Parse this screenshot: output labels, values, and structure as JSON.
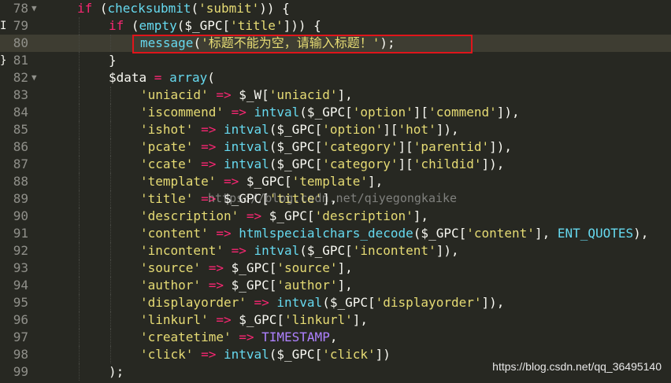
{
  "lines": [
    {
      "n": "78",
      "fold": "▼",
      "mark": "",
      "segs": [
        {
          "t": "if",
          "c": "kw"
        },
        {
          "t": " (",
          "c": "plain"
        },
        {
          "t": "checksubmit",
          "c": "fn"
        },
        {
          "t": "(",
          "c": "plain"
        },
        {
          "t": "'submit'",
          "c": "str"
        },
        {
          "t": ")) {",
          "c": "plain"
        }
      ],
      "indent": 1
    },
    {
      "n": "79",
      "fold": "",
      "mark": "I",
      "segs": [
        {
          "t": "if",
          "c": "kw"
        },
        {
          "t": " (",
          "c": "plain"
        },
        {
          "t": "empty",
          "c": "fn"
        },
        {
          "t": "($_GPC[",
          "c": "plain"
        },
        {
          "t": "'title'",
          "c": "str"
        },
        {
          "t": "])) {",
          "c": "plain"
        }
      ],
      "indent": 2
    },
    {
      "n": "80",
      "fold": "",
      "mark": "",
      "active": true,
      "segs": [
        {
          "t": "message",
          "c": "fn"
        },
        {
          "t": "(",
          "c": "plain"
        },
        {
          "t": "'标题不能为空，请输入标题！'",
          "c": "str"
        },
        {
          "t": ");",
          "c": "plain"
        }
      ],
      "indent": 3
    },
    {
      "n": "81",
      "fold": "",
      "mark": "}",
      "segs": [
        {
          "t": "}",
          "c": "plain"
        }
      ],
      "indent": 2
    },
    {
      "n": "82",
      "fold": "▼",
      "mark": "",
      "segs": [
        {
          "t": "$data",
          "c": "plain"
        },
        {
          "t": " = ",
          "c": "op"
        },
        {
          "t": "array",
          "c": "fn"
        },
        {
          "t": "(",
          "c": "plain"
        }
      ],
      "indent": 2
    },
    {
      "n": "83",
      "fold": "",
      "mark": "",
      "segs": [
        {
          "t": "'uniacid'",
          "c": "str"
        },
        {
          "t": " => ",
          "c": "op"
        },
        {
          "t": "$_W[",
          "c": "plain"
        },
        {
          "t": "'uniacid'",
          "c": "str"
        },
        {
          "t": "],",
          "c": "plain"
        }
      ],
      "indent": 3
    },
    {
      "n": "84",
      "fold": "",
      "mark": "",
      "segs": [
        {
          "t": "'iscommend'",
          "c": "str"
        },
        {
          "t": " => ",
          "c": "op"
        },
        {
          "t": "intval",
          "c": "fn"
        },
        {
          "t": "($_GPC[",
          "c": "plain"
        },
        {
          "t": "'option'",
          "c": "str"
        },
        {
          "t": "][",
          "c": "plain"
        },
        {
          "t": "'commend'",
          "c": "str"
        },
        {
          "t": "]),",
          "c": "plain"
        }
      ],
      "indent": 3
    },
    {
      "n": "85",
      "fold": "",
      "mark": "",
      "segs": [
        {
          "t": "'ishot'",
          "c": "str"
        },
        {
          "t": " => ",
          "c": "op"
        },
        {
          "t": "intval",
          "c": "fn"
        },
        {
          "t": "($_GPC[",
          "c": "plain"
        },
        {
          "t": "'option'",
          "c": "str"
        },
        {
          "t": "][",
          "c": "plain"
        },
        {
          "t": "'hot'",
          "c": "str"
        },
        {
          "t": "]),",
          "c": "plain"
        }
      ],
      "indent": 3
    },
    {
      "n": "86",
      "fold": "",
      "mark": "",
      "segs": [
        {
          "t": "'pcate'",
          "c": "str"
        },
        {
          "t": " => ",
          "c": "op"
        },
        {
          "t": "intval",
          "c": "fn"
        },
        {
          "t": "($_GPC[",
          "c": "plain"
        },
        {
          "t": "'category'",
          "c": "str"
        },
        {
          "t": "][",
          "c": "plain"
        },
        {
          "t": "'parentid'",
          "c": "str"
        },
        {
          "t": "]),",
          "c": "plain"
        }
      ],
      "indent": 3
    },
    {
      "n": "87",
      "fold": "",
      "mark": "",
      "segs": [
        {
          "t": "'ccate'",
          "c": "str"
        },
        {
          "t": " => ",
          "c": "op"
        },
        {
          "t": "intval",
          "c": "fn"
        },
        {
          "t": "($_GPC[",
          "c": "plain"
        },
        {
          "t": "'category'",
          "c": "str"
        },
        {
          "t": "][",
          "c": "plain"
        },
        {
          "t": "'childid'",
          "c": "str"
        },
        {
          "t": "]),",
          "c": "plain"
        }
      ],
      "indent": 3
    },
    {
      "n": "88",
      "fold": "",
      "mark": "",
      "segs": [
        {
          "t": "'template'",
          "c": "str"
        },
        {
          "t": " => ",
          "c": "op"
        },
        {
          "t": "$_GPC[",
          "c": "plain"
        },
        {
          "t": "'template'",
          "c": "str"
        },
        {
          "t": "],",
          "c": "plain"
        }
      ],
      "indent": 3
    },
    {
      "n": "89",
      "fold": "",
      "mark": "",
      "segs": [
        {
          "t": "'title'",
          "c": "str"
        },
        {
          "t": " => ",
          "c": "op"
        },
        {
          "t": "$_GPC[",
          "c": "plain"
        },
        {
          "t": "'title'",
          "c": "str"
        },
        {
          "t": "],",
          "c": "plain"
        }
      ],
      "indent": 3
    },
    {
      "n": "90",
      "fold": "",
      "mark": "",
      "segs": [
        {
          "t": "'description'",
          "c": "str"
        },
        {
          "t": " => ",
          "c": "op"
        },
        {
          "t": "$_GPC[",
          "c": "plain"
        },
        {
          "t": "'description'",
          "c": "str"
        },
        {
          "t": "],",
          "c": "plain"
        }
      ],
      "indent": 3
    },
    {
      "n": "91",
      "fold": "",
      "mark": "",
      "segs": [
        {
          "t": "'content'",
          "c": "str"
        },
        {
          "t": " => ",
          "c": "op"
        },
        {
          "t": "htmlspecialchars_decode",
          "c": "fn"
        },
        {
          "t": "($_GPC[",
          "c": "plain"
        },
        {
          "t": "'content'",
          "c": "str"
        },
        {
          "t": "], ",
          "c": "plain"
        },
        {
          "t": "ENT_QUOTES",
          "c": "fn"
        },
        {
          "t": "),",
          "c": "plain"
        }
      ],
      "indent": 3
    },
    {
      "n": "92",
      "fold": "",
      "mark": "",
      "segs": [
        {
          "t": "'incontent'",
          "c": "str"
        },
        {
          "t": " => ",
          "c": "op"
        },
        {
          "t": "intval",
          "c": "fn"
        },
        {
          "t": "($_GPC[",
          "c": "plain"
        },
        {
          "t": "'incontent'",
          "c": "str"
        },
        {
          "t": "]),",
          "c": "plain"
        }
      ],
      "indent": 3
    },
    {
      "n": "93",
      "fold": "",
      "mark": "",
      "segs": [
        {
          "t": "'source'",
          "c": "str"
        },
        {
          "t": " => ",
          "c": "op"
        },
        {
          "t": "$_GPC[",
          "c": "plain"
        },
        {
          "t": "'source'",
          "c": "str"
        },
        {
          "t": "],",
          "c": "plain"
        }
      ],
      "indent": 3
    },
    {
      "n": "94",
      "fold": "",
      "mark": "",
      "segs": [
        {
          "t": "'author'",
          "c": "str"
        },
        {
          "t": " => ",
          "c": "op"
        },
        {
          "t": "$_GPC[",
          "c": "plain"
        },
        {
          "t": "'author'",
          "c": "str"
        },
        {
          "t": "],",
          "c": "plain"
        }
      ],
      "indent": 3
    },
    {
      "n": "95",
      "fold": "",
      "mark": "",
      "segs": [
        {
          "t": "'displayorder'",
          "c": "str"
        },
        {
          "t": " => ",
          "c": "op"
        },
        {
          "t": "intval",
          "c": "fn"
        },
        {
          "t": "($_GPC[",
          "c": "plain"
        },
        {
          "t": "'displayorder'",
          "c": "str"
        },
        {
          "t": "]),",
          "c": "plain"
        }
      ],
      "indent": 3
    },
    {
      "n": "96",
      "fold": "",
      "mark": "",
      "segs": [
        {
          "t": "'linkurl'",
          "c": "str"
        },
        {
          "t": " => ",
          "c": "op"
        },
        {
          "t": "$_GPC[",
          "c": "plain"
        },
        {
          "t": "'linkurl'",
          "c": "str"
        },
        {
          "t": "],",
          "c": "plain"
        }
      ],
      "indent": 3
    },
    {
      "n": "97",
      "fold": "",
      "mark": "",
      "segs": [
        {
          "t": "'createtime'",
          "c": "str"
        },
        {
          "t": " => ",
          "c": "op"
        },
        {
          "t": "TIMESTAMP",
          "c": "const"
        },
        {
          "t": ",",
          "c": "plain"
        }
      ],
      "indent": 3
    },
    {
      "n": "98",
      "fold": "",
      "mark": "",
      "segs": [
        {
          "t": "'click'",
          "c": "str"
        },
        {
          "t": " => ",
          "c": "op"
        },
        {
          "t": "intval",
          "c": "fn"
        },
        {
          "t": "($_GPC[",
          "c": "plain"
        },
        {
          "t": "'click'",
          "c": "str"
        },
        {
          "t": "])",
          "c": "plain"
        }
      ],
      "indent": 3
    },
    {
      "n": "99",
      "fold": "",
      "mark": "",
      "segs": [
        {
          "t": ");",
          "c": "plain"
        }
      ],
      "indent": 2
    }
  ],
  "watermark_center": "https://blog.csdn.net/qiyegongkaike",
  "watermark_corner": "https://blog.csdn.net/qq_36495140",
  "colors": {
    "background": "#272822",
    "keyword": "#f92672",
    "function": "#66d9ef",
    "string": "#e6db74",
    "constant": "#ae81ff",
    "highlight_box": "#e0151b"
  }
}
